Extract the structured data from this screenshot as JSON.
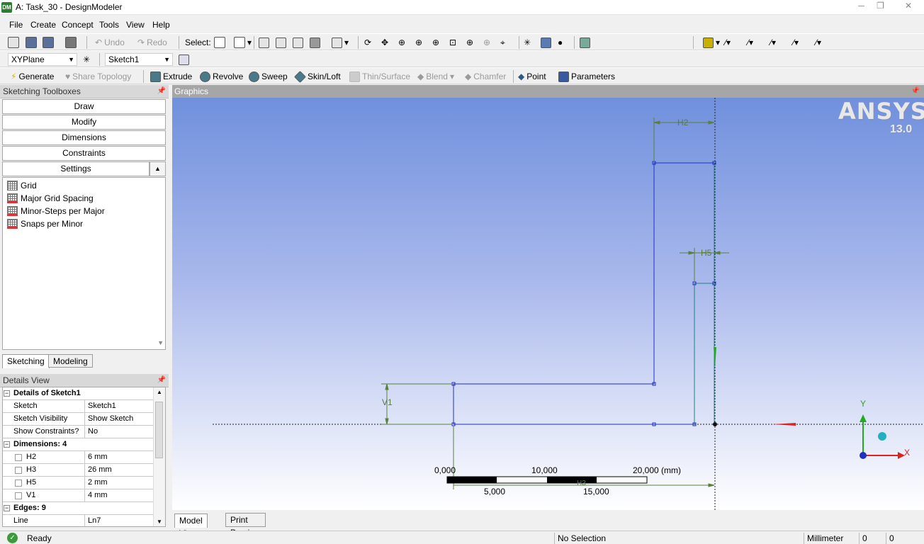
{
  "window": {
    "title": "A: Task_30 - DesignModeler",
    "app_icon": "DM"
  },
  "menu": [
    "File",
    "Create",
    "Concept",
    "Tools",
    "View",
    "Help"
  ],
  "toolbar1": {
    "undo": "Undo",
    "redo": "Redo",
    "select": "Select:"
  },
  "toolbar2": {
    "plane": "XYPlane",
    "sketch": "Sketch1"
  },
  "toolbar3": {
    "generate": "Generate",
    "share_topology": "Share Topology",
    "extrude": "Extrude",
    "revolve": "Revolve",
    "sweep": "Sweep",
    "skin_loft": "Skin/Loft",
    "thin_surface": "Thin/Surface",
    "blend": "Blend",
    "chamfer": "Chamfer",
    "point": "Point",
    "parameters": "Parameters"
  },
  "sketching_toolboxes": {
    "title": "Sketching Toolboxes",
    "sections": [
      "Draw",
      "Modify",
      "Dimensions",
      "Constraints",
      "Settings"
    ],
    "settings_items": [
      "Grid",
      "Major Grid Spacing",
      "Minor-Steps per Major",
      "Snaps per Minor"
    ],
    "tabs": [
      "Sketching",
      "Modeling"
    ]
  },
  "details_view": {
    "title": "Details View",
    "group1": "Details of Sketch1",
    "rows1": [
      {
        "label": "Sketch",
        "value": "Sketch1"
      },
      {
        "label": "Sketch Visibility",
        "value": "Show Sketch"
      },
      {
        "label": "Show Constraints?",
        "value": "No"
      }
    ],
    "group2": "Dimensions: 4",
    "dims": [
      {
        "label": "H2",
        "value": "6 mm"
      },
      {
        "label": "H3",
        "value": "26 mm"
      },
      {
        "label": "H5",
        "value": "2 mm"
      },
      {
        "label": "V1",
        "value": "4 mm"
      }
    ],
    "group3": "Edges: 9",
    "edge_row": {
      "label": "Line",
      "value": "Ln7"
    }
  },
  "graphics": {
    "title": "Graphics",
    "logo": "ANSYS",
    "version": "13.0",
    "dims": {
      "h2": "H2",
      "h5": "H5",
      "v1": "V1",
      "h3": "H3"
    },
    "scale": {
      "top": [
        "0,000",
        "10,000",
        "20,000 (mm)"
      ],
      "bottom": [
        "5,000",
        "15,000"
      ]
    },
    "axes": {
      "x": "X",
      "y": "Y"
    },
    "tabs": [
      "Model View",
      "Print Preview"
    ]
  },
  "status": {
    "ready": "Ready",
    "selection": "No Selection",
    "units": "Millimeter",
    "coord1": "0",
    "coord2": "0"
  },
  "colors": {
    "sketch_line": "#2030c0",
    "sketch_teal": "#208080",
    "dimension": "#5a8040",
    "x_axis": "#dd2222",
    "y_axis": "#22aa22"
  }
}
